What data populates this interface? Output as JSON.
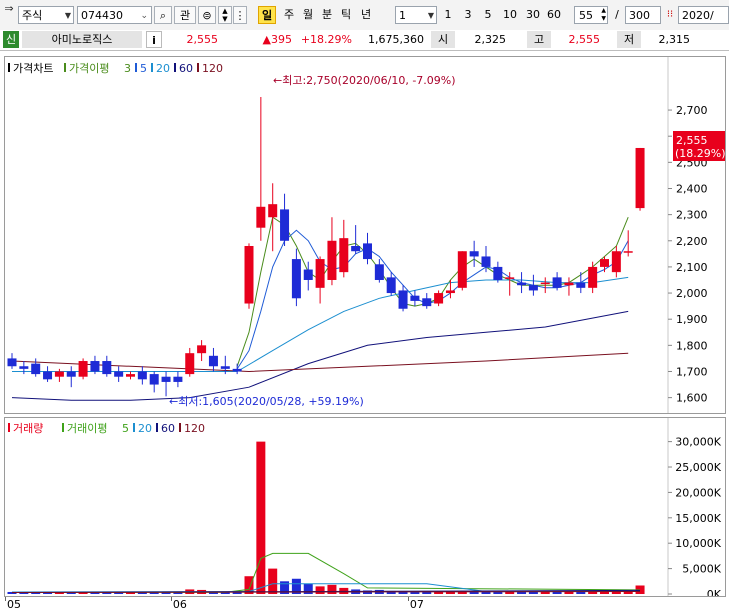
{
  "toolbar": {
    "market_label": "주식",
    "code_value": "074430",
    "watch_label": "관",
    "period_buttons": [
      "일",
      "주",
      "월",
      "분",
      "틱",
      "년"
    ],
    "interval_select": "1",
    "interval_buttons": [
      "1",
      "3",
      "5",
      "10",
      "30",
      "60"
    ],
    "count_value": "55",
    "slash": "/",
    "total_value": "300",
    "date_value": "2020/"
  },
  "info": {
    "badge": "신",
    "name": "아미노로직스",
    "info_icon": "i",
    "price": "2,555",
    "change": "▲395",
    "change_pct": "+18.29%",
    "volume": "1,675,360",
    "open_label": "시",
    "open_value": "2,325",
    "high_label": "고",
    "high_value": "2,555",
    "low_label": "저",
    "low_value": "2,315"
  },
  "price_legend": {
    "title": "가격차트",
    "ma_title": "가격이평",
    "ma_periods": [
      "3",
      "5",
      "20",
      "60",
      "120"
    ]
  },
  "volume_legend": {
    "title": "거래량",
    "ma_title": "거래이평",
    "ma_periods": [
      "5",
      "20",
      "60",
      "120"
    ]
  },
  "annotations": {
    "high": "←최고:2,750(2020/06/10, -7.09%)",
    "low": "←최저:1,605(2020/05/28, +59.19%)"
  },
  "current_price_label": "2,555",
  "current_pct_label": "(18.29%)",
  "colors": {
    "up": "#e8001c",
    "down": "#1e2bd6",
    "ma3": "#4a8c1c",
    "ma5": "#1f5bd6",
    "ma20": "#1c8fd0",
    "ma60": "#11117a",
    "ma120": "#7a1020",
    "vma5": "#3fa21a",
    "vma20": "#1c8fd0",
    "vma60": "#11117a",
    "vma120": "#7a1020"
  },
  "chart_data": [
    {
      "type": "candlestick",
      "title": "가격차트",
      "y_ticks": [
        1600,
        1700,
        1800,
        1900,
        2000,
        2100,
        2200,
        2300,
        2400,
        2500,
        2600,
        2700
      ],
      "y_tick_labels": [
        "1,600",
        "1,700",
        "1,800",
        "1,900",
        "2,000",
        "2,100",
        "2,200",
        "2,300",
        "2,400",
        "2,500",
        "2,600",
        "2,700"
      ],
      "ylim": [
        1545,
        2815
      ],
      "x_labels": [
        {
          "label": "05",
          "index": 0
        },
        {
          "label": "06",
          "index": 14
        },
        {
          "label": "07",
          "index": 34
        }
      ],
      "candles": [
        {
          "o": 1750,
          "h": 1770,
          "l": 1710,
          "c": 1720
        },
        {
          "o": 1720,
          "h": 1740,
          "l": 1690,
          "c": 1710
        },
        {
          "o": 1730,
          "h": 1750,
          "l": 1680,
          "c": 1690
        },
        {
          "o": 1700,
          "h": 1720,
          "l": 1660,
          "c": 1670
        },
        {
          "o": 1680,
          "h": 1710,
          "l": 1660,
          "c": 1700
        },
        {
          "o": 1700,
          "h": 1720,
          "l": 1640,
          "c": 1680
        },
        {
          "o": 1680,
          "h": 1750,
          "l": 1670,
          "c": 1740
        },
        {
          "o": 1740,
          "h": 1760,
          "l": 1690,
          "c": 1700
        },
        {
          "o": 1740,
          "h": 1760,
          "l": 1680,
          "c": 1690
        },
        {
          "o": 1700,
          "h": 1720,
          "l": 1660,
          "c": 1680
        },
        {
          "o": 1680,
          "h": 1700,
          "l": 1670,
          "c": 1690
        },
        {
          "o": 1700,
          "h": 1720,
          "l": 1650,
          "c": 1670
        },
        {
          "o": 1690,
          "h": 1700,
          "l": 1620,
          "c": 1650
        },
        {
          "o": 1680,
          "h": 1700,
          "l": 1605,
          "c": 1660
        },
        {
          "o": 1680,
          "h": 1700,
          "l": 1640,
          "c": 1660
        },
        {
          "o": 1690,
          "h": 1790,
          "l": 1680,
          "c": 1770
        },
        {
          "o": 1770,
          "h": 1820,
          "l": 1740,
          "c": 1800
        },
        {
          "o": 1760,
          "h": 1790,
          "l": 1700,
          "c": 1720
        },
        {
          "o": 1720,
          "h": 1760,
          "l": 1690,
          "c": 1710
        },
        {
          "o": 1710,
          "h": 1730,
          "l": 1690,
          "c": 1700
        },
        {
          "o": 1960,
          "h": 2190,
          "l": 1940,
          "c": 2180
        },
        {
          "o": 2250,
          "h": 2750,
          "l": 2200,
          "c": 2330
        },
        {
          "o": 2290,
          "h": 2420,
          "l": 2160,
          "c": 2340
        },
        {
          "o": 2320,
          "h": 2380,
          "l": 2180,
          "c": 2200
        },
        {
          "o": 2130,
          "h": 2170,
          "l": 1950,
          "c": 1980
        },
        {
          "o": 2090,
          "h": 2120,
          "l": 2010,
          "c": 2050
        },
        {
          "o": 2020,
          "h": 2140,
          "l": 1960,
          "c": 2130
        },
        {
          "o": 2050,
          "h": 2290,
          "l": 2030,
          "c": 2200
        },
        {
          "o": 2080,
          "h": 2280,
          "l": 2060,
          "c": 2210
        },
        {
          "o": 2180,
          "h": 2260,
          "l": 2150,
          "c": 2160
        },
        {
          "o": 2190,
          "h": 2230,
          "l": 2110,
          "c": 2130
        },
        {
          "o": 2110,
          "h": 2130,
          "l": 2040,
          "c": 2050
        },
        {
          "o": 2060,
          "h": 2080,
          "l": 1990,
          "c": 2000
        },
        {
          "o": 2010,
          "h": 2030,
          "l": 1930,
          "c": 1940
        },
        {
          "o": 1990,
          "h": 2010,
          "l": 1950,
          "c": 1970
        },
        {
          "o": 1980,
          "h": 2000,
          "l": 1940,
          "c": 1950
        },
        {
          "o": 1960,
          "h": 2010,
          "l": 1950,
          "c": 2000
        },
        {
          "o": 2000,
          "h": 2050,
          "l": 1980,
          "c": 2010
        },
        {
          "o": 2020,
          "h": 2160,
          "l": 2010,
          "c": 2160
        },
        {
          "o": 2160,
          "h": 2200,
          "l": 2100,
          "c": 2140
        },
        {
          "o": 2140,
          "h": 2180,
          "l": 2080,
          "c": 2100
        },
        {
          "o": 2100,
          "h": 2120,
          "l": 2040,
          "c": 2050
        },
        {
          "o": 2060,
          "h": 2080,
          "l": 1990,
          "c": 2060
        },
        {
          "o": 2040,
          "h": 2080,
          "l": 2000,
          "c": 2030
        },
        {
          "o": 2030,
          "h": 2070,
          "l": 1990,
          "c": 2010
        },
        {
          "o": 2040,
          "h": 2060,
          "l": 2000,
          "c": 2040
        },
        {
          "o": 2060,
          "h": 2080,
          "l": 2010,
          "c": 2020
        },
        {
          "o": 2030,
          "h": 2060,
          "l": 1990,
          "c": 2040
        },
        {
          "o": 2040,
          "h": 2080,
          "l": 2000,
          "c": 2020
        },
        {
          "o": 2020,
          "h": 2120,
          "l": 2000,
          "c": 2100
        },
        {
          "o": 2100,
          "h": 2140,
          "l": 2080,
          "c": 2130
        },
        {
          "o": 2080,
          "h": 2180,
          "l": 2060,
          "c": 2160
        },
        {
          "o": 2160,
          "h": 2240,
          "l": 2140,
          "c": 2160
        },
        {
          "o": 2325,
          "h": 2555,
          "l": 2315,
          "c": 2555
        }
      ],
      "moving_averages": [
        {
          "name": "3",
          "x": [
            19,
            20,
            21,
            22,
            23,
            24,
            25,
            26,
            27,
            28,
            29,
            30,
            31,
            32,
            33,
            34,
            35,
            36,
            37,
            38,
            39,
            40,
            41,
            42,
            43,
            44,
            45,
            46,
            47,
            48,
            49,
            50,
            51,
            52
          ],
          "values": [
            1720,
            1850,
            2080,
            2290,
            2260,
            2180,
            2080,
            2050,
            2120,
            2180,
            2190,
            2150,
            2090,
            2020,
            1960,
            1950,
            1960,
            1980,
            2050,
            2100,
            2130,
            2100,
            2070,
            2050,
            2030,
            2030,
            2030,
            2030,
            2040,
            2070,
            2100,
            2140,
            2180,
            2290
          ]
        },
        {
          "name": "5",
          "x": [
            19,
            20,
            21,
            22,
            23,
            24,
            25,
            26,
            27,
            28,
            29,
            30,
            31,
            32,
            33,
            34,
            35,
            36,
            37,
            38,
            39,
            40,
            41,
            42,
            43,
            44,
            45,
            46,
            47,
            48,
            49,
            50,
            51,
            52
          ],
          "values": [
            1710,
            1780,
            1930,
            2100,
            2200,
            2240,
            2200,
            2120,
            2090,
            2100,
            2150,
            2170,
            2140,
            2080,
            2030,
            1980,
            1960,
            1970,
            2000,
            2040,
            2070,
            2100,
            2090,
            2060,
            2040,
            2030,
            2020,
            2020,
            2030,
            2040,
            2070,
            2090,
            2120,
            2200
          ]
        },
        {
          "name": "20",
          "x": [
            0,
            10,
            19,
            22,
            25,
            28,
            31,
            34,
            37,
            40,
            43,
            46,
            49,
            52
          ],
          "values": [
            1700,
            1700,
            1700,
            1780,
            1860,
            1930,
            1980,
            2010,
            2040,
            2050,
            2050,
            2040,
            2040,
            2060
          ]
        },
        {
          "name": "60",
          "x": [
            0,
            5,
            10,
            15,
            20,
            25,
            30,
            35,
            40,
            45,
            52
          ],
          "values": [
            1600,
            1590,
            1590,
            1600,
            1640,
            1730,
            1800,
            1830,
            1850,
            1870,
            1930
          ]
        },
        {
          "name": "120",
          "x": [
            0,
            10,
            20,
            30,
            40,
            52
          ],
          "values": [
            1740,
            1720,
            1700,
            1720,
            1740,
            1770
          ]
        }
      ]
    },
    {
      "type": "bar",
      "title": "거래량",
      "y_ticks": [
        0,
        5000,
        10000,
        15000,
        20000,
        25000,
        30000
      ],
      "y_tick_labels": [
        "0K",
        "5,000K",
        "10,000K",
        "15,000K",
        "20,000K",
        "25,000K",
        "30,000K"
      ],
      "ylim": [
        0,
        31500
      ],
      "values": [
        400,
        300,
        300,
        400,
        300,
        300,
        400,
        300,
        300,
        300,
        300,
        300,
        300,
        300,
        300,
        900,
        800,
        400,
        300,
        300,
        3500,
        30000,
        5000,
        2500,
        3000,
        2000,
        1500,
        1800,
        1200,
        900,
        700,
        800,
        600,
        500,
        400,
        400,
        400,
        500,
        600,
        700,
        600,
        500,
        400,
        400,
        400,
        400,
        400,
        500,
        400,
        400,
        500,
        700,
        800,
        1675
      ],
      "directions": [
        "d",
        "d",
        "d",
        "d",
        "u",
        "d",
        "u",
        "d",
        "d",
        "d",
        "u",
        "d",
        "d",
        "d",
        "d",
        "u",
        "u",
        "d",
        "d",
        "d",
        "u",
        "u",
        "u",
        "d",
        "d",
        "d",
        "u",
        "u",
        "u",
        "d",
        "d",
        "d",
        "d",
        "d",
        "d",
        "d",
        "u",
        "u",
        "u",
        "d",
        "d",
        "d",
        "u",
        "d",
        "d",
        "u",
        "d",
        "u",
        "d",
        "u",
        "u",
        "u",
        "u",
        "u"
      ],
      "moving_averages": [
        {
          "name": "5",
          "x": [
            0,
            18,
            20,
            21,
            22,
            25,
            28,
            30,
            53
          ],
          "values": [
            350,
            350,
            900,
            7000,
            8000,
            8000,
            4000,
            1200,
            800
          ]
        },
        {
          "name": "20",
          "x": [
            0,
            20,
            22,
            35,
            40,
            53
          ],
          "values": [
            400,
            500,
            2000,
            2000,
            500,
            600
          ]
        },
        {
          "name": "60",
          "x": [
            0,
            53
          ],
          "values": [
            300,
            700
          ]
        },
        {
          "name": "120",
          "x": [
            0,
            53
          ],
          "values": [
            300,
            500
          ]
        }
      ]
    }
  ]
}
